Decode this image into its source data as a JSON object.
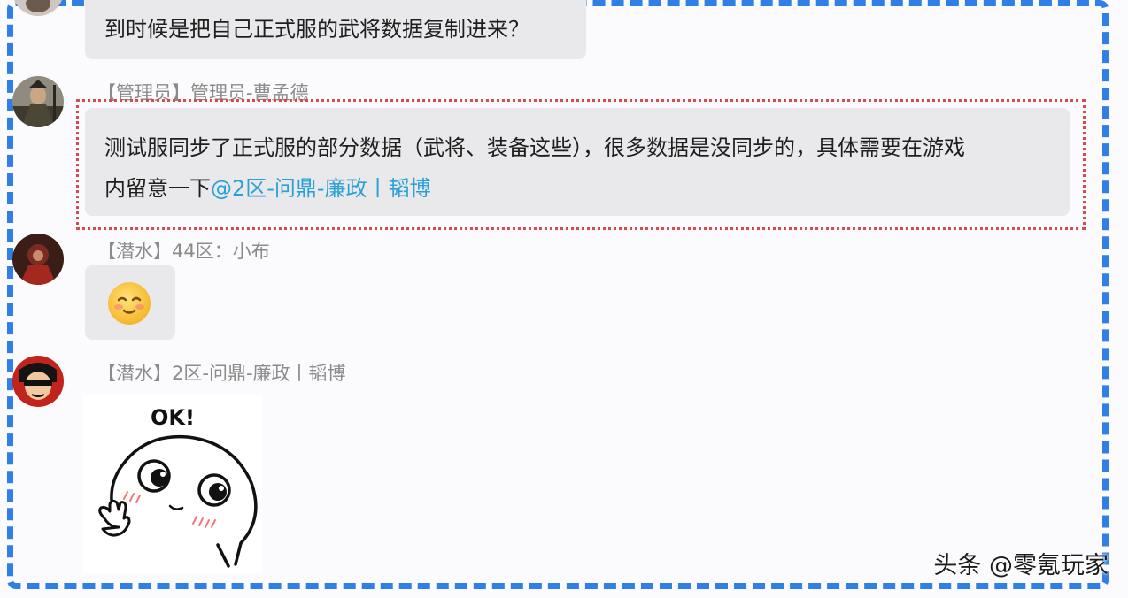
{
  "messages": [
    {
      "text": "到时候是把自己正式服的武将数据复制进来？"
    },
    {
      "sender": "【管理员】管理员-曹孟德",
      "text_main": "测试服同步了正式服的部分数据（武将、装备这些），很多数据是没同步的，具体需要在游戏",
      "text_line2": "内留意一下",
      "mention": "@2区-问鼎-廉政丨韬博"
    },
    {
      "sender": "【潜水】44区：小布",
      "emoji": "☺"
    },
    {
      "sender": "【潜水】2区-问鼎-廉政丨韬博",
      "sticker_caption": "OK!"
    }
  ],
  "watermark": "头条 @零氪玩家",
  "colors": {
    "frame": "#2f7fe6",
    "highlight": "#d84b4b",
    "bubble": "#e9e8ea",
    "mention": "#2aa1d6"
  }
}
